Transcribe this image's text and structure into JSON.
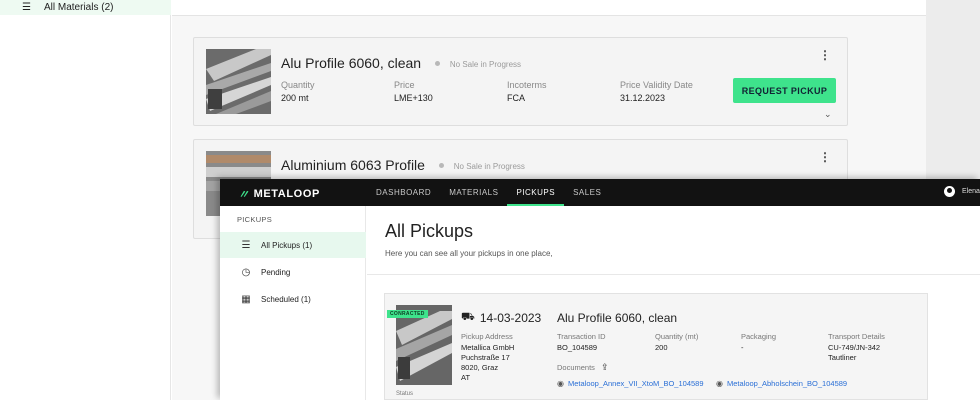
{
  "background_window": {
    "sidebar": {
      "nav_item_label": "All Materials (2)"
    },
    "materials": [
      {
        "name": "Alu Profile 6060, clean",
        "status": "No Sale in Progress",
        "fields": [
          {
            "label": "Quantity",
            "value": "200 mt"
          },
          {
            "label": "Price",
            "value": "LME+130"
          },
          {
            "label": "Incoterms",
            "value": "FCA"
          },
          {
            "label": "Price Validity Date",
            "value": "31.12.2023"
          }
        ],
        "action_label": "REQUEST PICKUP"
      },
      {
        "name": "Aluminium 6063 Profile",
        "status": "No Sale in Progress"
      }
    ]
  },
  "app": {
    "logo_text": "METALOOP",
    "nav": [
      "DASHBOARD",
      "MATERIALS",
      "PICKUPS",
      "SALES"
    ],
    "active_nav": "PICKUPS",
    "user_name": "Elena"
  },
  "sidebar": {
    "title": "PICKUPS",
    "items": [
      {
        "label": "All Pickups (1)",
        "icon": "list-icon",
        "active": true
      },
      {
        "label": "Pending",
        "icon": "clock-icon",
        "active": false
      },
      {
        "label": "Scheduled (1)",
        "icon": "calendar-icon",
        "active": false
      }
    ]
  },
  "page": {
    "title": "All Pickups",
    "subtitle": "Here you can see all your pickups in one place,"
  },
  "pickup": {
    "badge": "CONRACTED",
    "date": "14-03-2023",
    "material": "Alu Profile 6060, clean",
    "address_label": "Pickup Address",
    "address_lines": [
      "Metallica GmbH",
      "Puchstraße 17",
      "8020, Graz",
      "AT"
    ],
    "transaction_label": "Transaction ID",
    "transaction_id": "BO_104589",
    "quantity_label": "Quantity (mt)",
    "quantity": "200",
    "packaging_label": "Packaging",
    "packaging": "-",
    "transport_label": "Transport Details",
    "transport_lines": [
      "CU-749/JN-342",
      "Tautliner"
    ],
    "documents_label": "Documents",
    "documents": [
      "Metaloop_Annex_VII_XtoM_BO_104589",
      "Metaloop_Abholschein_BO_104589"
    ],
    "status_label": "Status"
  },
  "colors": {
    "accent": "#3ee38c",
    "header": "#121212",
    "link": "#2a6fd6"
  }
}
